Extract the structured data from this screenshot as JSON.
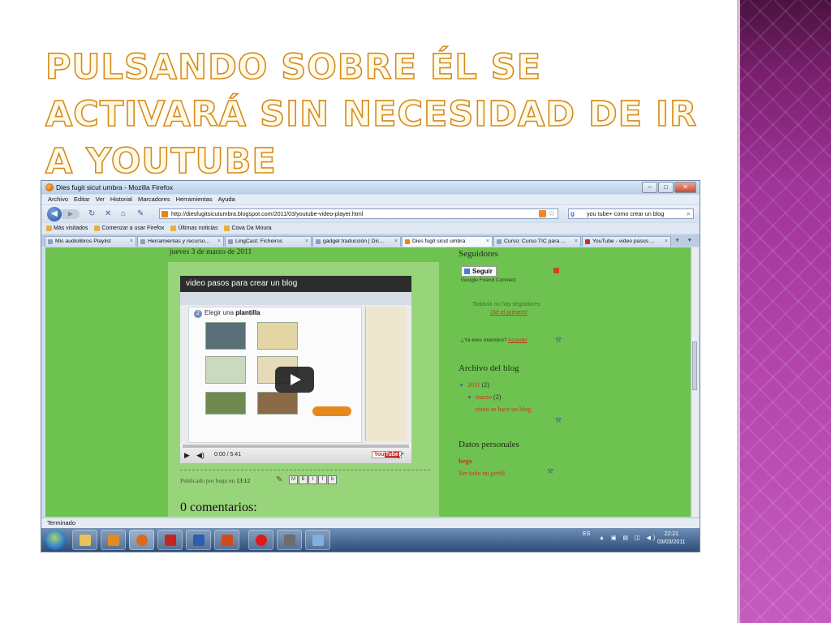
{
  "slide": {
    "title": "Pulsando sobre él se activará sin necesidad de ir a YouTube"
  },
  "browser": {
    "window_title": "Dies fugit sicut umbra - Mozilla Firefox",
    "menu": [
      "Archivo",
      "Editar",
      "Ver",
      "Historial",
      "Marcadores",
      "Herramientas",
      "Ayuda"
    ],
    "url": "http://diesfugitsicutumbra.blogspot.com/2011/03/youtube-video-player.html",
    "search_value": "you tube+ como crear un blog",
    "bookmarks": [
      "Más visitados",
      "Comenzar a usar Firefox",
      "Últimas noticias",
      "Cova Da Moura"
    ],
    "tabs": [
      {
        "label": "Mis audiolibros Playlist",
        "active": false
      },
      {
        "label": "Herramientas y recurso...",
        "active": false
      },
      {
        "label": "LingCast: Ficheiros",
        "active": false
      },
      {
        "label": "gadget traducción | Dic...",
        "active": false
      },
      {
        "label": "Dies fugit sicut umbra",
        "active": true
      },
      {
        "label": "Curso: Curso TIC para ...",
        "active": false
      },
      {
        "label": "YouTube - video pasos ...",
        "active": false
      }
    ],
    "status": "Terminado"
  },
  "blog": {
    "date": "jueves 3 de marzo de 2011",
    "video": {
      "title": "video pasos para crear un blog",
      "step_number": "2",
      "step_prefix": "Elegir una",
      "step_bold": "plantilla",
      "time": "0:00 / 5:41",
      "youtube_you": "You",
      "youtube_tube": "Tube"
    },
    "published_prefix": "Publicado por bego en",
    "published_time": "13:12",
    "comments": "0 comentarios:"
  },
  "sidebar": {
    "followers_heading": "Seguidores",
    "follow_button": "Seguir",
    "gfc": "Google Friend Connect",
    "no_followers": "Todavía no hay seguidores",
    "be_first": "¡Sé el primero!",
    "member_prefix": "¿Ya eres miembro?",
    "member_link": "Acceder",
    "archive_heading": "Archivo del blog",
    "archive_year": "2011",
    "archive_year_count": "(2)",
    "archive_month": "marzo",
    "archive_month_count": "(2)",
    "archive_post": "cómo se hace un blog",
    "profile_heading": "Datos personales",
    "profile_name": "bego",
    "profile_link": "Ver todo mi perfil"
  },
  "taskbar": {
    "lang": "ES",
    "time": "22:21",
    "date": "03/03/2011"
  },
  "colors": {
    "page_green": "#6ec24f",
    "post_green": "#98d47a",
    "title_outline": "#d68a1c",
    "link_red": "#c33a1e"
  }
}
